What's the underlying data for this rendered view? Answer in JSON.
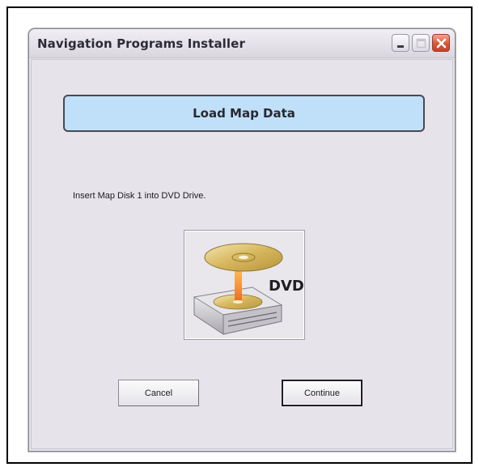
{
  "window": {
    "title": "Navigation Programs Installer",
    "controls": {
      "minimize_icon": "minimize-icon",
      "maximize_icon": "maximize-icon",
      "close_icon": "close-icon"
    }
  },
  "banner": {
    "text": "Load Map Data",
    "color": "#bfe0f8"
  },
  "instruction": {
    "text": "Insert Map Disk 1 into DVD Drive."
  },
  "image": {
    "label": "DVD",
    "icon": "dvd-drive-icon"
  },
  "buttons": {
    "cancel_label": "Cancel",
    "continue_label": "Continue"
  },
  "colors": {
    "window_bg": "#e6e3ea",
    "close_button": "#d65737",
    "disc_gold": "#d9bd6a",
    "laser_orange": "#f08a2c"
  }
}
